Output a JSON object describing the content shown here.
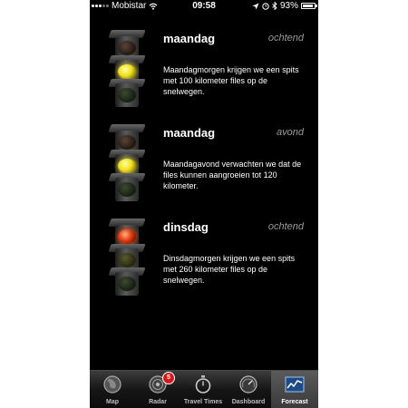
{
  "status_bar": {
    "carrier": "Mobistar",
    "time": "09:58",
    "battery": "93%",
    "battery_level": 0.93
  },
  "forecasts": [
    {
      "day": "maandag",
      "period": "ochtend",
      "light": "yellow",
      "description": "Maandagmorgen krijgen we een spits met 100 kilometer files op de snelwegen."
    },
    {
      "day": "maandag",
      "period": "avond",
      "light": "yellow",
      "description": "Maandagavond verwachten we dat de files kunnen aangroeien tot 120 kilometer."
    },
    {
      "day": "dinsdag",
      "period": "ochtend",
      "light": "red",
      "description": "Dinsdagmorgen krijgen we een spits met 260 kilometer files op de snelwegen."
    }
  ],
  "tab_bar": {
    "tabs": [
      {
        "label": "Map",
        "icon": "globe-icon"
      },
      {
        "label": "Radar",
        "icon": "radar-icon",
        "badge": "5"
      },
      {
        "label": "Travel Times",
        "icon": "stopwatch-icon"
      },
      {
        "label": "Dashboard",
        "icon": "speedometer-icon"
      },
      {
        "label": "Forecast",
        "icon": "chart-icon",
        "active": true
      }
    ]
  }
}
